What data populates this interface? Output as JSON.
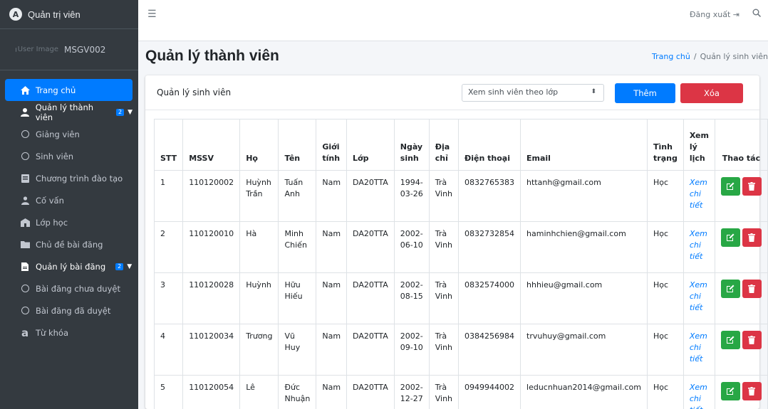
{
  "brand": {
    "logo_letter": "A",
    "title": "Quản trị viên"
  },
  "user": {
    "image_alt": "User Image",
    "name": "MSGV002"
  },
  "sidebar": {
    "items": [
      {
        "label": "Trang chủ",
        "icon": "home-icon"
      },
      {
        "label": "Quản lý thành viên",
        "icon": "user-icon",
        "badge": "2"
      },
      {
        "label": "Giảng viên",
        "icon": "circle-icon"
      },
      {
        "label": "Sinh viên",
        "icon": "circle-icon"
      },
      {
        "label": "Chương trình đào tạo",
        "icon": "book-icon"
      },
      {
        "label": "Cố vấn",
        "icon": "users-icon"
      },
      {
        "label": "Lớp học",
        "icon": "school-icon"
      },
      {
        "label": "Chủ đề bài đăng",
        "icon": "folder-icon"
      },
      {
        "label": "Quản lý bài đăng",
        "icon": "file-icon",
        "badge": "2"
      },
      {
        "label": "Bài đăng chưa duyệt",
        "icon": "circle-icon"
      },
      {
        "label": "Bài đăng đã duyệt",
        "icon": "circle-icon"
      },
      {
        "label": "Từ khóa",
        "icon": "amazon-icon"
      }
    ]
  },
  "topbar": {
    "logout": "Đăng xuất"
  },
  "page": {
    "title": "Quản lý thành viên",
    "breadcrumb_home": "Trang chủ",
    "breadcrumb_sep": "/",
    "breadcrumb_current": "Quản lý sinh viên"
  },
  "card": {
    "title": "Quản lý sinh viên",
    "select_value": "Xem sinh viên theo lớp",
    "add_label": "Thêm",
    "delete_label": "Xóa"
  },
  "table": {
    "headers": [
      "STT",
      "MSSV",
      "Họ",
      "Tên",
      "Giới tính",
      "Lớp",
      "Ngày sinh",
      "Địa chỉ",
      "Điện thoại",
      "Email",
      "Tình trạng",
      "Xem lý lịch",
      "Thao tác"
    ],
    "rows": [
      [
        "1",
        "110120002",
        "Huỳnh Trần",
        "Tuấn Anh",
        "Nam",
        "DA20TTA",
        "1994-03-26",
        "Trà Vinh",
        "0832765383",
        "httanh@gmail.com",
        "Học",
        "Xem chi tiết"
      ],
      [
        "2",
        "110120010",
        "Hà",
        "Minh Chiến",
        "Nam",
        "DA20TTA",
        "2002-06-10",
        "Trà Vinh",
        "0832732854",
        "haminhchien@gmail.com",
        "Học",
        "Xem chi tiết"
      ],
      [
        "3",
        "110120028",
        "Huỳnh",
        "Hữu Hiếu",
        "Nam",
        "DA20TTA",
        "2002-08-15",
        "Trà Vinh",
        "0832574000",
        "hhhieu@gmail.com",
        "Học",
        "Xem chi tiết"
      ],
      [
        "4",
        "110120034",
        "Trương",
        "Vũ Huy",
        "Nam",
        "DA20TTA",
        "2002-09-10",
        "Trà Vinh",
        "0384256984",
        "trvuhuy@gmail.com",
        "Học",
        "Xem chi tiết"
      ],
      [
        "5",
        "110120054",
        "Lê",
        "Đức Nhuận",
        "Nam",
        "DA20TTA",
        "2002-12-27",
        "Trà Vinh",
        "0949944002",
        "leducnhuan2014@gmail.com",
        "Học",
        "Xem chi tiết"
      ]
    ]
  },
  "colors": {
    "primary": "#007bff",
    "danger": "#dc3545",
    "success": "#28a745",
    "sidebar": "#343a40"
  }
}
